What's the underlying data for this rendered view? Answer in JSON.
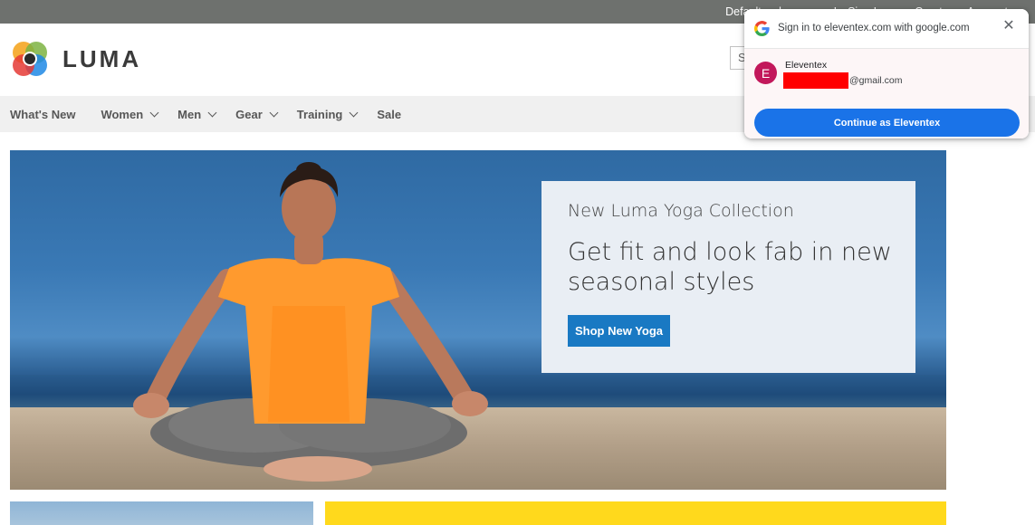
{
  "top_bar": {
    "welcome": "Default welcome msg!",
    "sign_in": "Sign In",
    "or": "or",
    "create_account": "Create an Account"
  },
  "header": {
    "logo_text": "LUMA",
    "search_placeholder": "S"
  },
  "nav": {
    "items": [
      {
        "label": "What's New"
      },
      {
        "label": "Women"
      },
      {
        "label": "Men"
      },
      {
        "label": "Gear"
      },
      {
        "label": "Training"
      },
      {
        "label": "Sale"
      }
    ]
  },
  "hero": {
    "subtitle": "New Luma Yoga Collection",
    "title": "Get fit and look fab in new seasonal styles",
    "button": "Shop New Yoga"
  },
  "google_signin": {
    "title": "Sign in to eleventex.com with google.com",
    "close_icon": "close-icon",
    "account_initial": "E",
    "account_name": "Eleventex",
    "account_email_suffix": "@gmail.com",
    "continue_button": "Continue as Eleventex"
  },
  "colors": {
    "top_bar": "#6e716e",
    "nav_bg": "#f0f0f0",
    "primary_button": "#1979c3",
    "google_button": "#1a73e8",
    "avatar": "#c2185b",
    "yellow_block": "#ffd91c"
  }
}
